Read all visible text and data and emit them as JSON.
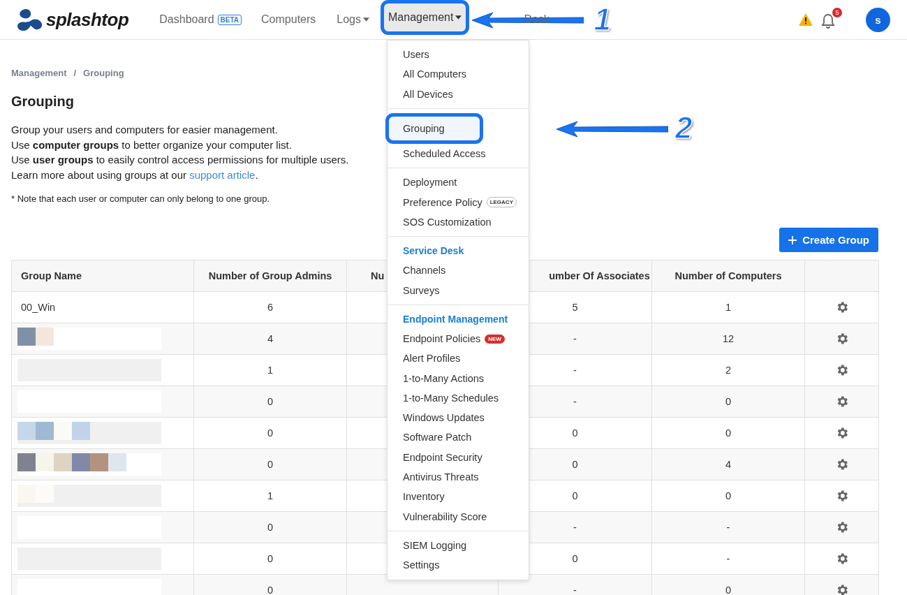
{
  "nav": {
    "brand": "splashtop",
    "items": [
      {
        "label": "Dashboard",
        "badge": "BETA",
        "caret": false,
        "selected": false
      },
      {
        "label": "Computers",
        "caret": false,
        "selected": false
      },
      {
        "label": "Logs",
        "caret": true,
        "selected": false
      },
      {
        "label": "Management",
        "caret": true,
        "selected": true,
        "annotation": "1"
      },
      {
        "label": "Desk",
        "caret": false,
        "selected": false
      }
    ],
    "notifications": "5",
    "avatar": "s"
  },
  "breadcrumb": {
    "items": [
      "Management",
      "Grouping"
    ],
    "separator": "/"
  },
  "title": "Grouping",
  "intro": [
    "Group your users and computers for easier management.",
    "Use **computer groups** to better organize your computer list.",
    "Use **user groups** to easily control access permissions for multiple users."
  ],
  "learn_more": {
    "text": "Learn more about using groups at our",
    "link": "support article",
    "end": "."
  },
  "note": "* Note that each user or computer can only belong to one group.",
  "create_button": "Create Group",
  "table": {
    "columns": [
      "Group Name",
      "Number of Group Admins",
      "Nu",
      "umber Of Associates",
      "Number of Computers"
    ],
    "rows": [
      {
        "name": "00_Win",
        "redacted": false,
        "admins": "6",
        "associates": "5",
        "computers": "1"
      },
      {
        "redacted": true,
        "admins": "4",
        "associates": "-",
        "computers": "12"
      },
      {
        "redacted": true,
        "admins": "1",
        "associates": "-",
        "computers": "2"
      },
      {
        "redacted": true,
        "admins": "0",
        "associates": "-",
        "computers": "0"
      },
      {
        "redacted": true,
        "admins": "0",
        "associates": "0",
        "computers": "0"
      },
      {
        "redacted": true,
        "admins": "0",
        "associates": "0",
        "computers": "4"
      },
      {
        "redacted": true,
        "admins": "1",
        "associates": "0",
        "computers": "0"
      },
      {
        "redacted": true,
        "admins": "0",
        "associates": "-",
        "computers": "-"
      },
      {
        "redacted": true,
        "admins": "0",
        "associates": "0",
        "computers": "-"
      },
      {
        "redacted": true,
        "admins": "0",
        "associates": "-",
        "computers": "0"
      }
    ]
  },
  "menu": [
    {
      "items": [
        {
          "label": "Users",
          "selected": false
        },
        {
          "label": "All Computers",
          "selected": false
        },
        {
          "label": "All Devices",
          "selected": false
        }
      ]
    },
    {
      "items": [
        {
          "label": "Grouping",
          "selected": true,
          "annotation": "2"
        },
        {
          "label": "Scheduled Access",
          "selected": false
        }
      ]
    },
    {
      "items": [
        {
          "label": "Deployment",
          "selected": false
        },
        {
          "label": "Preference Policy",
          "badge": "LEGACY",
          "kind": "legacy",
          "selected": false
        },
        {
          "label": "SOS Customization",
          "selected": false
        }
      ]
    },
    {
      "header": "Service Desk",
      "items": [
        {
          "label": "Channels",
          "selected": false
        },
        {
          "label": "Surveys",
          "selected": false
        }
      ]
    },
    {
      "header": "Endpoint Management",
      "items": [
        {
          "label": "Endpoint Policies",
          "badge": "NEW",
          "kind": "new",
          "selected": false
        },
        {
          "label": "Alert Profiles",
          "selected": false
        },
        {
          "label": "1-to-Many Actions",
          "selected": false
        },
        {
          "label": "1-to-Many Schedules",
          "selected": false
        },
        {
          "label": "Windows Updates",
          "selected": false
        },
        {
          "label": "Software Patch",
          "selected": false
        },
        {
          "label": "Endpoint Security",
          "selected": false
        },
        {
          "label": "Antivirus Threats",
          "selected": false
        },
        {
          "label": "Inventory",
          "selected": false
        },
        {
          "label": "Vulnerability Score",
          "selected": false
        }
      ]
    },
    {
      "items": [
        {
          "label": "SIEM Logging",
          "selected": false
        },
        {
          "label": "Settings",
          "selected": false
        }
      ]
    }
  ]
}
